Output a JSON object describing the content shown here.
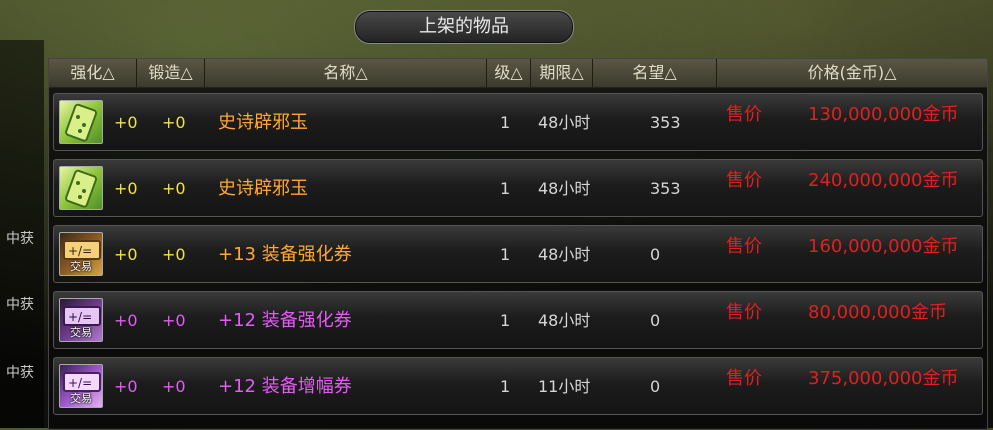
{
  "window": {
    "title": "上架的物品"
  },
  "sidebar": {
    "tabs": [
      "中获",
      "中获",
      "中获"
    ]
  },
  "table": {
    "headers": {
      "enhance": "强化△",
      "forge": "锻造△",
      "name": "名称△",
      "level": "级△",
      "duration": "期限△",
      "fame": "名望△",
      "price": "价格(金币)△"
    },
    "rows": [
      {
        "icon": "jade-scroll-icon",
        "icon_label": "",
        "enhance": "+0",
        "forge": "+0",
        "name": "史诗辟邪玉",
        "level": "1",
        "duration": "48小时",
        "fame": "353",
        "price_label": "售价",
        "price": "130,000,000金币"
      },
      {
        "icon": "jade-scroll-icon",
        "icon_label": "",
        "enhance": "+0",
        "forge": "+0",
        "name": "史诗辟邪玉",
        "level": "1",
        "duration": "48小时",
        "fame": "353",
        "price_label": "售价",
        "price": "240,000,000金币"
      },
      {
        "icon": "enhance-ticket-icon",
        "icon_label": "交易",
        "enhance": "+0",
        "forge": "+0",
        "name": "+13 装备强化券",
        "level": "1",
        "duration": "48小时",
        "fame": "0",
        "price_label": "售价",
        "price": "160,000,000金币"
      },
      {
        "icon": "enhance-ticket-icon",
        "icon_label": "交易",
        "enhance": "+0",
        "forge": "+0",
        "name": "+12 装备强化券",
        "level": "1",
        "duration": "48小时",
        "fame": "0",
        "price_label": "售价",
        "price": "80,000,000金币"
      },
      {
        "icon": "amplify-ticket-icon",
        "icon_label": "交易",
        "enhance": "+0",
        "forge": "+0",
        "name": "+12 装备增幅券",
        "level": "1",
        "duration": "11小时",
        "fame": "0",
        "price_label": "售价",
        "price": "375,000,000金币"
      }
    ]
  },
  "colors": {
    "price_red": "#e02020",
    "epic_orange": "#ffa735",
    "rare_purple": "#e25cf3",
    "stat_yellow": "#f2e24a"
  }
}
